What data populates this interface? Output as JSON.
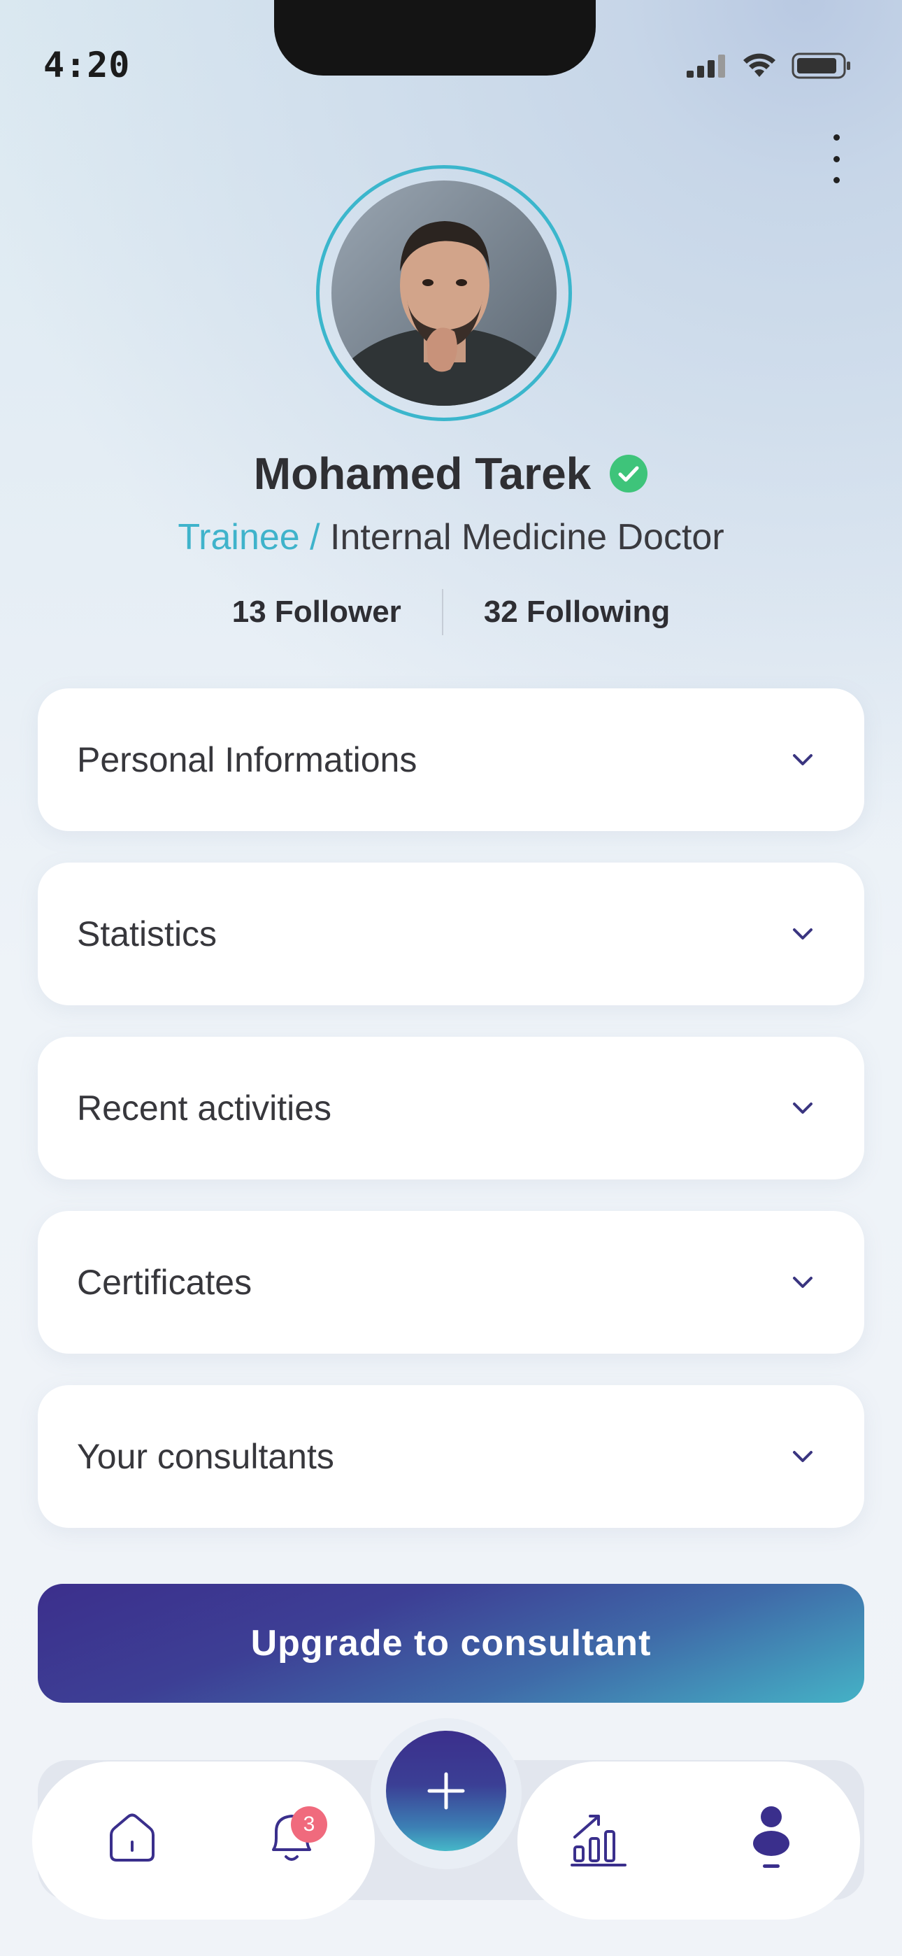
{
  "status_bar": {
    "time": "4:20"
  },
  "profile": {
    "name": "Mohamed Tarek",
    "role_prefix": "Trainee /",
    "role": " Internal Medicine Doctor",
    "followers": "13 Follower",
    "following": "32 Following"
  },
  "sections": [
    {
      "label": "Personal Informations"
    },
    {
      "label": "Statistics"
    },
    {
      "label": "Recent activities"
    },
    {
      "label": "Certificates"
    },
    {
      "label": "Your consultants"
    }
  ],
  "upgrade_button": {
    "label": "Upgrade to consultant"
  },
  "bottom_nav": {
    "notifications_badge": "3",
    "items": [
      "home-icon",
      "bell-icon",
      "add-icon",
      "chart-icon",
      "profile-icon"
    ]
  },
  "colors": {
    "accent": "#3fb3cb",
    "primary": "#3b2f8c",
    "verified": "#3ec47a",
    "badge": "#f06a7d"
  }
}
